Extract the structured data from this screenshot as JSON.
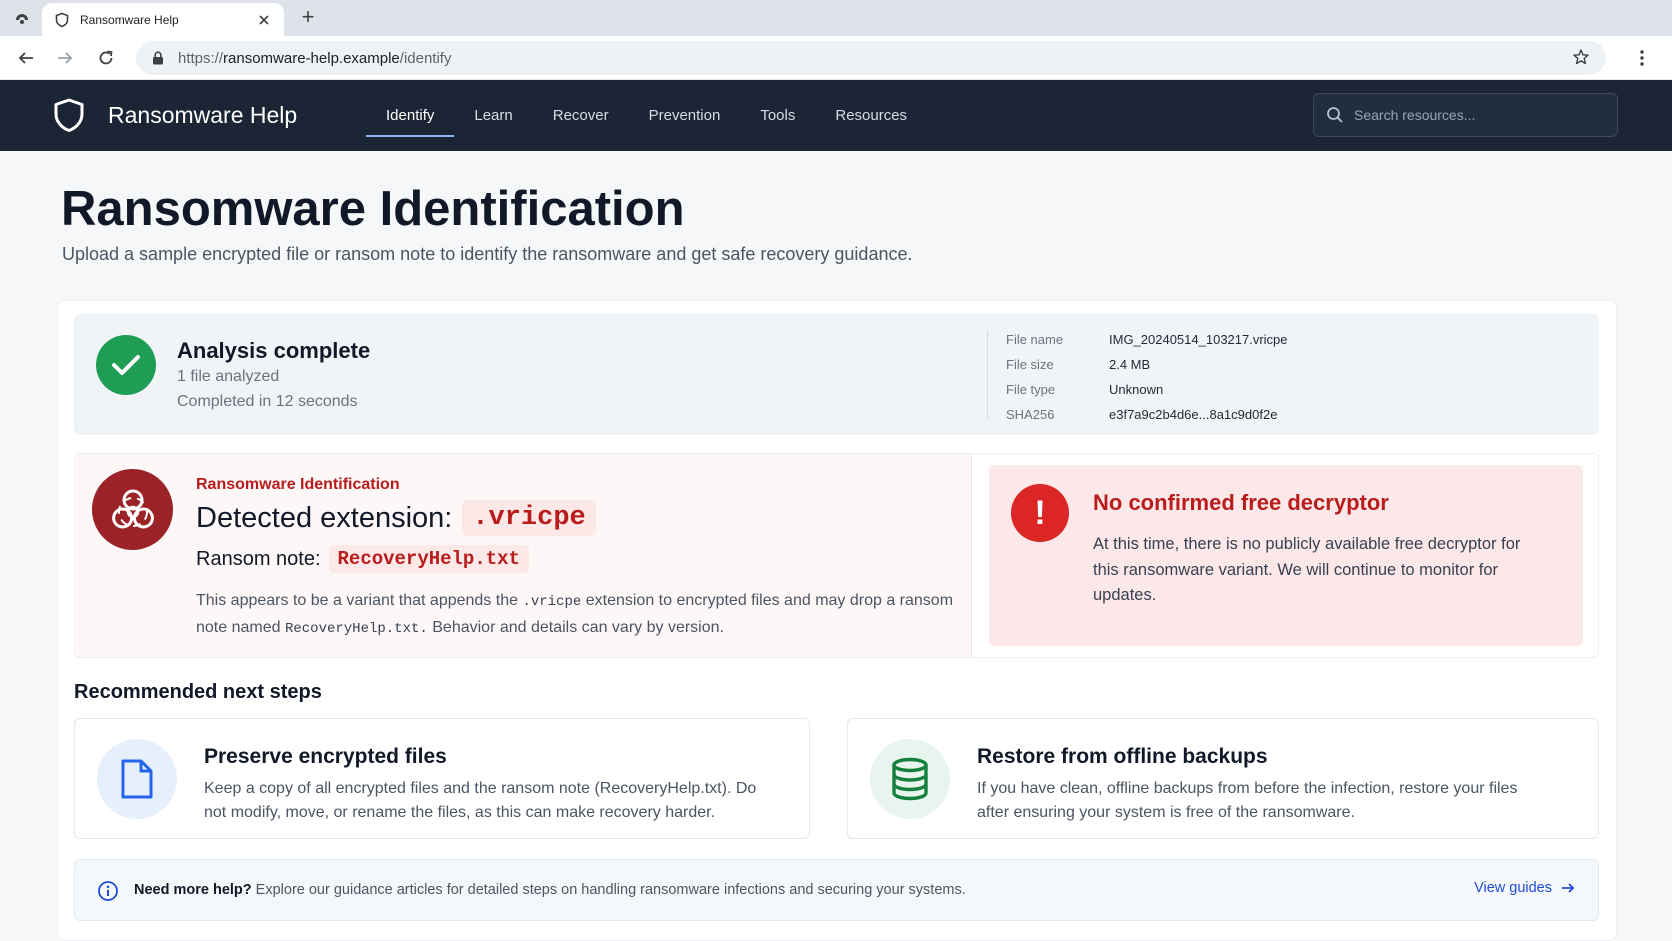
{
  "browser": {
    "tab_title": "Ransomware Help",
    "new_tab_symbol": "+",
    "url_scheme": "https://",
    "url_domain": "ransomware-help.example",
    "url_path": "/identify"
  },
  "site": {
    "brand": "Ransomware Help",
    "nav": [
      {
        "label": "Identify",
        "active": true
      },
      {
        "label": "Learn"
      },
      {
        "label": "Recover"
      },
      {
        "label": "Prevention"
      },
      {
        "label": "Tools"
      },
      {
        "label": "Resources"
      }
    ],
    "search_placeholder": "Search resources..."
  },
  "page": {
    "title": "Ransomware Identification",
    "subtitle": "Upload a sample encrypted file or ransom note to identify the ransomware and get safe recovery guidance."
  },
  "analysis": {
    "title": "Analysis complete",
    "files": "1 file analyzed",
    "duration": "Completed in 12 seconds",
    "meta": [
      {
        "label": "File name",
        "value": "IMG_20240514_103217.vricpe"
      },
      {
        "label": "File size",
        "value": "2.4 MB"
      },
      {
        "label": "File type",
        "value": "Unknown"
      },
      {
        "label": "SHA256",
        "value": "e3f7a9c2b4d6e...8a1c9d0f2e"
      }
    ]
  },
  "detection": {
    "kicker": "Ransomware Identification",
    "ext_label": "Detected extension:",
    "ext_value": ".vricpe",
    "note_label": "Ransom note:",
    "note_value": "RecoveryHelp.txt",
    "desc_1": "This appears to be a variant that appends the",
    "desc_ext": ".vricpe",
    "desc_2": "extension to encrypted files and may drop a ransom note named",
    "desc_note": "RecoveryHelp.txt.",
    "desc_3": "Behavior and details can vary by version."
  },
  "decryptor": {
    "icon_symbol": "!",
    "title": "No confirmed free decryptor",
    "body": "At this time, there is no publicly available free decryptor for this ransomware variant. We will continue to monitor for updates."
  },
  "recommended": {
    "heading": "Recommended next steps",
    "steps": [
      {
        "title": "Preserve encrypted files",
        "desc": "Keep a copy of all encrypted files and the ransom note (RecoveryHelp.txt). Do not modify, move, or rename the files, as this can make recovery harder.",
        "icon": "file-icon",
        "color": "#2563eb"
      },
      {
        "title": "Restore from offline backups",
        "desc": "If you have clean, offline backups from before the infection, restore your files after ensuring your system is free of the ransomware.",
        "icon": "database-icon",
        "color": "#15803d"
      }
    ]
  },
  "help": {
    "strong": "Need more help?",
    "text": "Explore our guidance articles for detailed steps on handling ransomware infections and securing your systems.",
    "link": "View guides"
  },
  "colors": {
    "header_bg": "#1b2535",
    "success": "#1f9d55",
    "danger": "#b91c1c",
    "accent": "#1d4ed8"
  }
}
